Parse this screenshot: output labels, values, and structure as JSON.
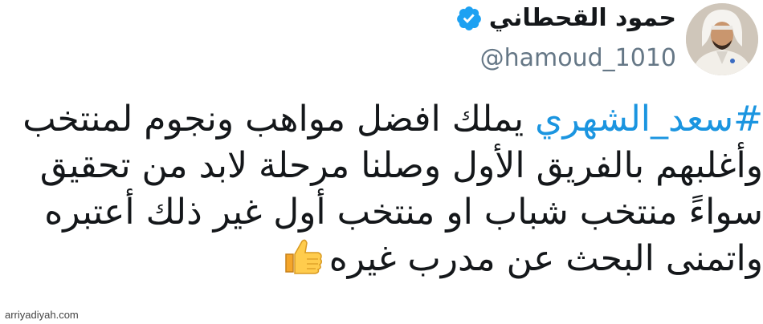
{
  "author": {
    "display_name": "حمود القحطاني",
    "handle": "@hamoud_1010",
    "verified": true,
    "avatar": "profile-photo"
  },
  "tweet": {
    "line1_hashtag": "#سعد_الشهري",
    "line1_text": " يملك افضل مواهب ونجوم لمنتخب",
    "line2": "وأغلبهم بالفريق الأول وصلنا مرحلة لابد من تحقيق",
    "line3": "سواءً منتخب شباب او منتخب أول غير ذلك أعتبره",
    "line4": "واتمنى البحث عن مدرب غيره",
    "line4_emoji": "thumbs-up-icon"
  },
  "watermark": "arriyadiyah.com",
  "colors": {
    "hashtag": "#1b95e0",
    "verified_badge": "#1da1f2",
    "handle": "#657786",
    "text": "#14171a"
  }
}
